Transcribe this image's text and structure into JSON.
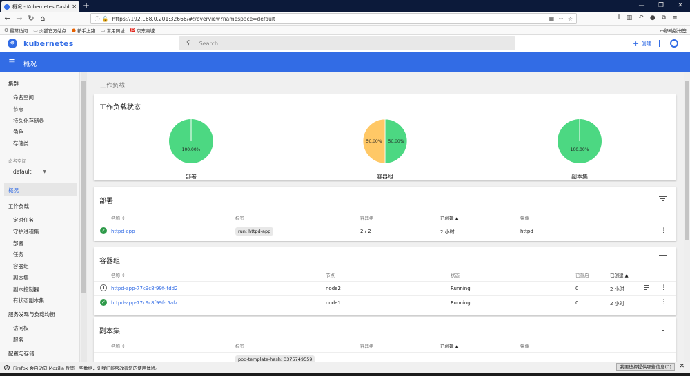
{
  "browser": {
    "tab_title": "概况 - Kubernetes Dashboard",
    "url": "https://192.168.0.201:32666/#!/overview?namespace=default",
    "bookmarks": [
      "最常访问",
      "火狐官方站点",
      "新手上路",
      "常用网址",
      "京东商城"
    ],
    "bookmarks_right": "移动版书签",
    "notice_text": "Firefox 会自动向 Mozilla 反馈一些数据，让我们能够改善您的使用体验。",
    "notice_button": "我要选择提供哪些信息(C)"
  },
  "app": {
    "brand": "kubernetes",
    "search_placeholder": "Search",
    "create_label": "创建",
    "page_title": "概况"
  },
  "sidebar": {
    "cluster": "集群",
    "cluster_items": [
      "命名空间",
      "节点",
      "持久化存储卷",
      "角色",
      "存储类"
    ],
    "namespace_label": "命名空间",
    "namespace_value": "default",
    "overview": "概况",
    "workloads": "工作负载",
    "workload_items": [
      "定时任务",
      "守护进程集",
      "部署",
      "任务",
      "容器组",
      "副本集",
      "副本控制器",
      "有状态副本集"
    ],
    "discovery": "服务发现与负载均衡",
    "discovery_items": [
      "访问权",
      "服务"
    ],
    "config": "配置与存储"
  },
  "main": {
    "breadcrumb": "工作负载",
    "status_title": "工作负载状态",
    "deployments_title": "部署",
    "pods_title": "容器组",
    "replicasets_title": "副本集"
  },
  "chart_data": {
    "type": "pie",
    "charts": [
      {
        "label": "部署",
        "slices": [
          {
            "name": "running",
            "value": 100.0,
            "color": "#4cd882",
            "text": "100.00%"
          }
        ]
      },
      {
        "label": "容器组",
        "slices": [
          {
            "name": "running",
            "value": 50.0,
            "color": "#4cd882",
            "text": "50.00%"
          },
          {
            "name": "pending",
            "value": 50.0,
            "color": "#ffc866",
            "text": "50.00%"
          }
        ]
      },
      {
        "label": "副本集",
        "slices": [
          {
            "name": "running",
            "value": 100.0,
            "color": "#4cd882",
            "text": "100.00%"
          }
        ]
      }
    ]
  },
  "deployments": {
    "headers": {
      "name": "名称",
      "labels": "标签",
      "pods": "容器组",
      "created": "已创建",
      "images": "镜像"
    },
    "rows": [
      {
        "name": "httpd-app",
        "label": "run: httpd-app",
        "pods": "2 / 2",
        "created": "2 小时",
        "image": "httpd"
      }
    ]
  },
  "pods": {
    "headers": {
      "name": "名称",
      "node": "节点",
      "status": "状态",
      "restarts": "已重启",
      "created": "已创建"
    },
    "rows": [
      {
        "name": "httpd-app-77c9c8f99f-jtdd2",
        "node": "node2",
        "status": "Running",
        "restarts": "0",
        "created": "2 小时"
      },
      {
        "name": "httpd-app-77c9c8f99f-r5afz",
        "node": "node1",
        "status": "Running",
        "restarts": "0",
        "created": "2 小时"
      }
    ]
  },
  "replicasets": {
    "headers": {
      "name": "名称",
      "labels": "标签",
      "pods": "容器组",
      "created": "已创建",
      "images": "镜像"
    },
    "first_label": "pod-template-hash: 3375749559"
  },
  "colors": {
    "accent": "#326ce5",
    "ok": "#2e9a49"
  }
}
